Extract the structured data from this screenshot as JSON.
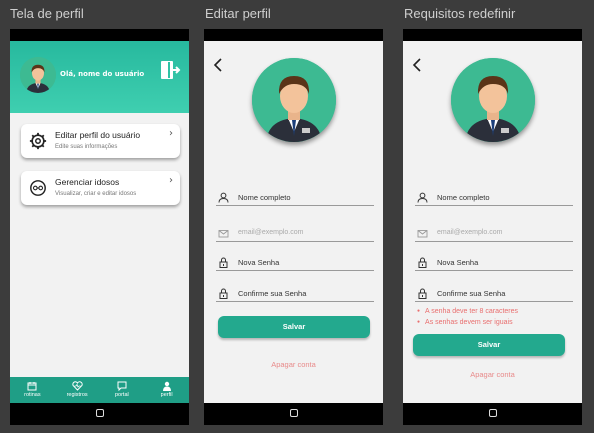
{
  "panels": {
    "profile_title": "Tela de perfil",
    "edit_title": "Editar perfil",
    "reqs_title": "Requisitos redefinir"
  },
  "profile": {
    "greeting": "Olá, nome do usuário",
    "cards": [
      {
        "title": "Editar perfil do usuário",
        "subtitle": "Edite suas informações",
        "icon": "gear-icon"
      },
      {
        "title": "Gerenciar idosos",
        "subtitle": "Visualizar, criar e editar idosos",
        "icon": "elder-icon"
      }
    ],
    "tabs": [
      {
        "label": "rotinas",
        "icon": "calendar-icon"
      },
      {
        "label": "registros",
        "icon": "heart-icon"
      },
      {
        "label": "portal",
        "icon": "chat-icon"
      },
      {
        "label": "perfil",
        "icon": "user-icon"
      }
    ]
  },
  "form": {
    "name_placeholder": "Nome completo",
    "email_placeholder": "email@exemplo.com",
    "password_label": "Nova Senha",
    "confirm_label": "Confirme sua Senha",
    "save_label": "Salvar",
    "delete_label": "Apagar conta"
  },
  "errors": {
    "min_length": "A senha deve ter 8 caracteres",
    "mismatch": "As senhas devem ser iguais"
  },
  "colors": {
    "accent": "#23a98e",
    "header": "#2fc2a5",
    "error": "#e96f6f"
  }
}
